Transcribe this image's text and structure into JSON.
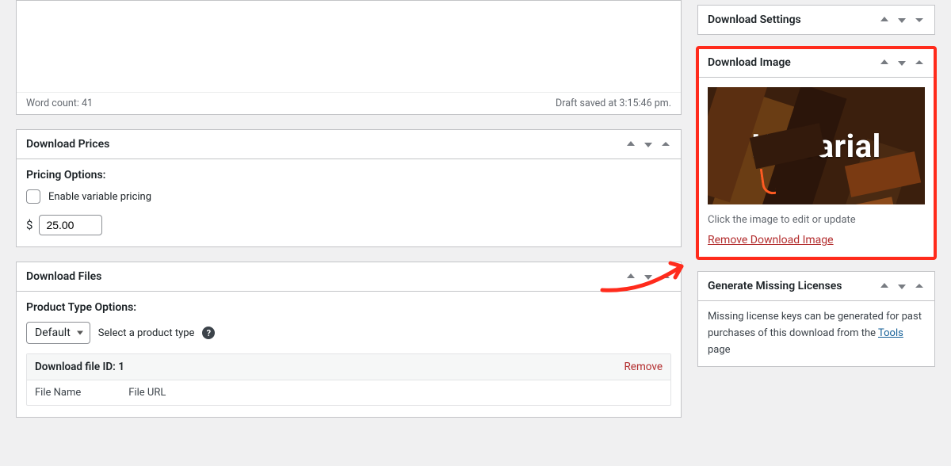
{
  "editor": {
    "word_count_label": "Word count: 41",
    "draft_saved_label": "Draft saved at 3:15:46 pm."
  },
  "prices_panel": {
    "title": "Download Prices",
    "options_label": "Pricing Options:",
    "variable_pricing_label": "Enable variable pricing",
    "currency_symbol": "$",
    "price_value": "25.00"
  },
  "files_panel": {
    "title": "Download Files",
    "product_type_label": "Product Type Options:",
    "product_type_value": "Default",
    "product_type_hint": "Select a product type",
    "file_id_label": "Download file ID: 1",
    "remove_label": "Remove",
    "col_filename": "File Name",
    "col_fileurl": "File URL"
  },
  "settings_panel": {
    "title": "Download Settings"
  },
  "image_panel": {
    "title": "Download Image",
    "thumb_text": "Helvarial",
    "caption": "Click the image to edit or update",
    "remove_link": "Remove Download Image"
  },
  "licenses_panel": {
    "title": "Generate Missing Licenses",
    "body_before": "Missing license keys can be generated for past purchases of this download from the ",
    "tools_link": "Tools",
    "body_after": " page"
  }
}
